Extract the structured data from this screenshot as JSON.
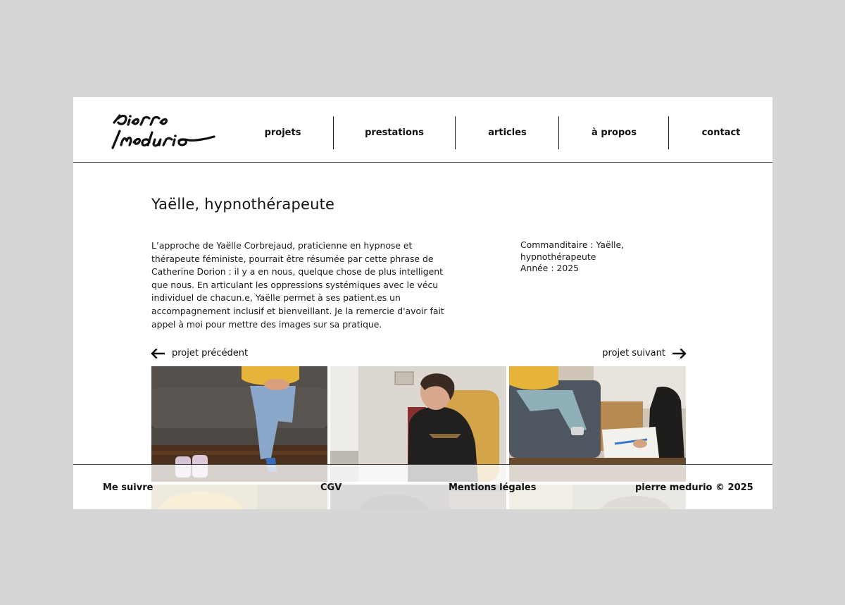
{
  "header": {
    "logo_text": "pierre medurio",
    "nav": [
      {
        "label": "projets"
      },
      {
        "label": "prestations"
      },
      {
        "label": "articles"
      },
      {
        "label": "à propos"
      },
      {
        "label": "contact"
      }
    ]
  },
  "project": {
    "title": "Yaëlle, hypnothérapeute",
    "description": "L’approche de Yaëlle Corbrejaud, praticienne en hypnose et thérapeute féministe, pourrait être résumée par cette phrase de Catherine Dorion : il y a en nous, quelque chose de plus intelligent que nous. En articulant les oppressions systémiques avec le vécu individuel de chacun.e, Yaëlle permet à ses patient.es un accompagnement inclusif et bienveillant. Je la remercie d'avoir fait appel à moi pour mettre des images sur sa pratique.",
    "client_line_1": "Commanditaire : Yaëlle,",
    "client_line_2": "hypnothérapeute",
    "year_line": "Année : 2025"
  },
  "project_nav": {
    "previous": "projet précédent",
    "next": "projet suivant"
  },
  "footer": {
    "follow": "Me suivre",
    "cgv": "CGV",
    "legal": "Mentions légales",
    "copyright": "pierre medurio © 2025"
  }
}
